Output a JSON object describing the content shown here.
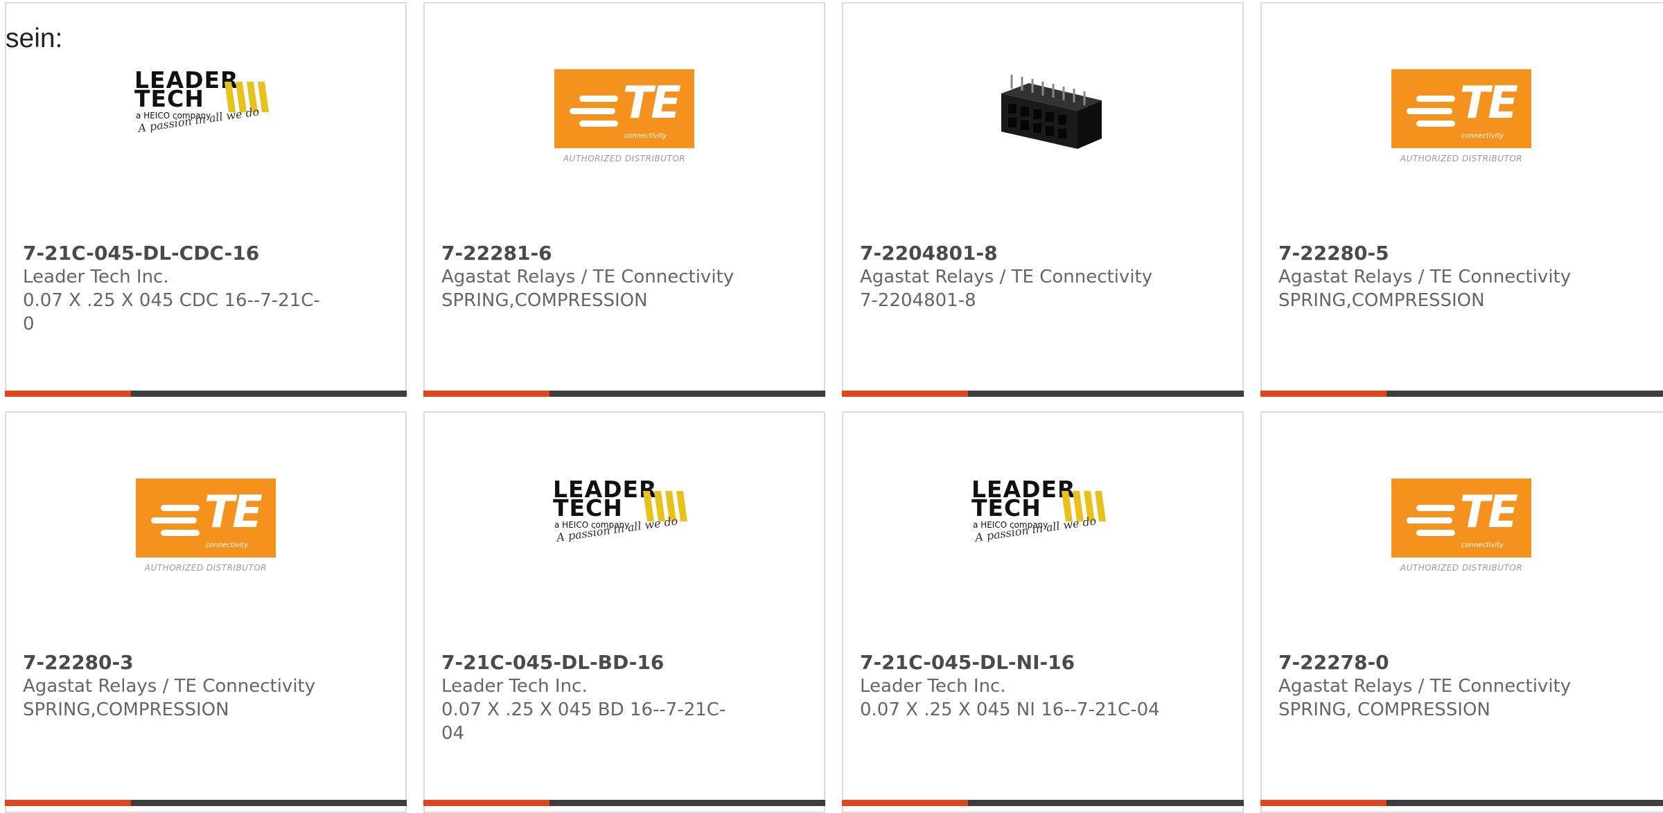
{
  "page": {
    "fragment_text": "sein:"
  },
  "colors": {
    "accent": "#e2451c",
    "bar_dark": "#3d3d3d",
    "te_orange": "#f5921e",
    "leader_yellow": "#e8c11c"
  },
  "products": [
    {
      "part_number": "7-21C-045-DL-CDC-16",
      "manufacturer": "Leader Tech Inc.",
      "description_line1": "0.07 X .25 X 045 CDC 16--7-21C-",
      "description_line2": "0",
      "image": "leader-tech-logo"
    },
    {
      "part_number": "7-22281-6",
      "manufacturer": "Agastat Relays / TE Connectivity",
      "description_line1": "SPRING,COMPRESSION",
      "description_line2": "",
      "image": "te-connectivity-logo"
    },
    {
      "part_number": "7-2204801-8",
      "manufacturer": "Agastat Relays / TE Connectivity",
      "description_line1": "7-2204801-8",
      "description_line2": "",
      "image": "connector-product-photo"
    },
    {
      "part_number": "7-22280-5",
      "manufacturer": "Agastat Relays / TE Connectivity",
      "description_line1": "SPRING,COMPRESSION",
      "description_line2": "",
      "image": "te-connectivity-logo"
    },
    {
      "part_number": "7-22280-3",
      "manufacturer": "Agastat Relays / TE Connectivity",
      "description_line1": "SPRING,COMPRESSION",
      "description_line2": "",
      "image": "te-connectivity-logo"
    },
    {
      "part_number": "7-21C-045-DL-BD-16",
      "manufacturer": "Leader Tech Inc.",
      "description_line1": "0.07 X .25 X 045 BD 16--7-21C-",
      "description_line2": "04",
      "image": "leader-tech-logo"
    },
    {
      "part_number": "7-21C-045-DL-NI-16",
      "manufacturer": "Leader Tech Inc.",
      "description_line1": "0.07 X .25 X 045 NI 16--7-21C-04",
      "description_line2": "",
      "image": "leader-tech-logo"
    },
    {
      "part_number": "7-22278-0",
      "manufacturer": "Agastat Relays / TE Connectivity",
      "description_line1": "SPRING, COMPRESSION",
      "description_line2": "",
      "image": "te-connectivity-logo"
    }
  ],
  "logos": {
    "te": {
      "letters": "TE",
      "sub": "connectivity",
      "tagline": "AUTHORIZED DISTRIBUTOR"
    },
    "leader": {
      "name_line1": "LEADER",
      "name_line2": "TECH",
      "sub": "a HEICO company",
      "slogan": "A passion in all we do"
    }
  }
}
